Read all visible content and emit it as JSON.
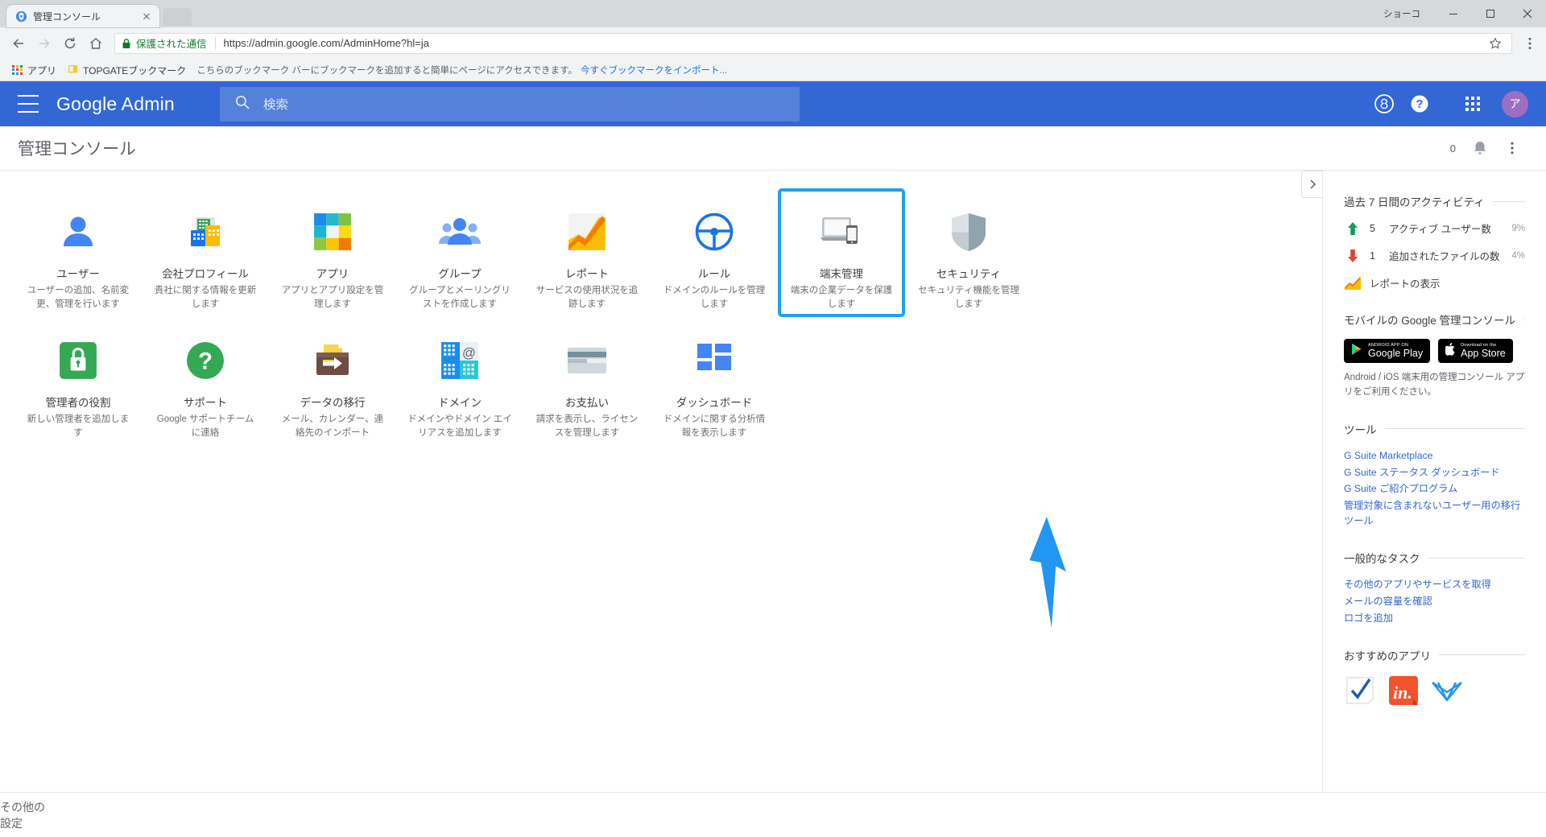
{
  "browser": {
    "tab": {
      "title": "管理コンソール",
      "favicon": "admin-console-favicon"
    },
    "window_label": "ショーコ",
    "omnibox": {
      "secure_text": "保護された通信",
      "url_prefix": "https://",
      "url_domain": "admin.google.com",
      "url_path": "/AdminHome?hl=ja",
      "url_full": "https://admin.google.com/AdminHome?hl=ja"
    },
    "bookmarks": {
      "apps_label": "アプリ",
      "item_label": "TOPGATEブックマーク",
      "note": "こちらのブックマーク バーにブックマークを追加すると簡単にページにアクセスできます。",
      "import_link": "今すぐブックマークをインポート..."
    }
  },
  "topbar": {
    "brand": "Google Admin",
    "search_placeholder": "検索",
    "avatar_letter": "ア"
  },
  "titlebar": {
    "title": "管理コンソール",
    "notification_count": "0"
  },
  "tiles": [
    {
      "name": "ユーザー",
      "desc": "ユーザーの追加、名前変更、管理を行います",
      "icon": "person-icon",
      "highlight": false
    },
    {
      "name": "会社プロフィール",
      "desc": "貴社に関する情報を更新します",
      "icon": "company-profile-icon",
      "highlight": false
    },
    {
      "name": "アプリ",
      "desc": "アプリとアプリ設定を管理します",
      "icon": "apps-squares-icon",
      "highlight": false
    },
    {
      "name": "グループ",
      "desc": "グループとメーリングリストを作成します",
      "icon": "groups-icon",
      "highlight": false
    },
    {
      "name": "レポート",
      "desc": "サービスの使用状況を追跡します",
      "icon": "reports-chart-icon",
      "highlight": false
    },
    {
      "name": "ルール",
      "desc": "ドメインのルールを管理します",
      "icon": "steering-wheel-icon",
      "highlight": false
    },
    {
      "name": "端末管理",
      "desc": "端末の企業データを保護します",
      "icon": "device-management-icon",
      "highlight": true
    },
    {
      "name": "セキュリティ",
      "desc": "セキュリティ機能を管理します",
      "icon": "shield-icon",
      "highlight": false
    },
    {
      "name": "管理者の役割",
      "desc": "新しい管理者を追加します",
      "icon": "lock-icon",
      "highlight": false
    },
    {
      "name": "サポート",
      "desc": "Google サポートチームに連絡",
      "icon": "question-mark-icon",
      "highlight": false
    },
    {
      "name": "データの移行",
      "desc": "メール、カレンダー、連絡先のインポート",
      "icon": "data-migration-icon",
      "highlight": false
    },
    {
      "name": "ドメイン",
      "desc": "ドメインやドメイン エイリアスを追加します",
      "icon": "domains-icon",
      "highlight": false
    },
    {
      "name": "お支払い",
      "desc": "請求を表示し、ライセンスを管理します",
      "icon": "credit-card-icon",
      "highlight": false
    },
    {
      "name": "ダッシュボード",
      "desc": "ドメインに関する分析情報を表示します",
      "icon": "dashboard-icon",
      "highlight": false
    }
  ],
  "right_panel": {
    "activity": {
      "title": "過去 7 日間のアクティビティ",
      "rows": [
        {
          "direction": "up",
          "count": "5",
          "label": "アクティブ ユーザー数",
          "pct": "9%"
        },
        {
          "direction": "down",
          "count": "1",
          "label": "追加されたファイルの数",
          "pct": "4%"
        }
      ],
      "view_reports": "レポートの表示"
    },
    "mobile": {
      "title": "モバイルの Google 管理コンソール",
      "google_play": {
        "sub": "ANDROID APP ON",
        "main": "Google Play"
      },
      "app_store": {
        "sub": "Download on the",
        "main": "App Store"
      },
      "note": "Android / iOS 端末用の管理コンソール アプリをご利用ください。"
    },
    "tools": {
      "title": "ツール",
      "links": [
        "G Suite Marketplace",
        "G Suite ステータス ダッシュボード",
        "G Suite ご紹介プログラム",
        "管理対象に含まれないユーザー用の移行ツール"
      ]
    },
    "common_tasks": {
      "title": "一般的なタスク",
      "links": [
        "その他のアプリやサービスを取得",
        "メールの容量を確認",
        "ロゴを追加"
      ]
    },
    "recommended": {
      "title": "おすすめのアプリ",
      "apps": [
        "smartsheet-icon",
        "invision-icon",
        "xero-icon"
      ]
    }
  },
  "bottom": {
    "more_settings": "その他の設定"
  },
  "colors": {
    "brand_blue": "#3367d6",
    "highlight_blue": "#1fa2e8",
    "link_blue": "#3367d6",
    "green": "#0f9d58",
    "red": "#db4437",
    "yellow": "#f4b400",
    "avatar_purple": "#9c6fc3"
  }
}
